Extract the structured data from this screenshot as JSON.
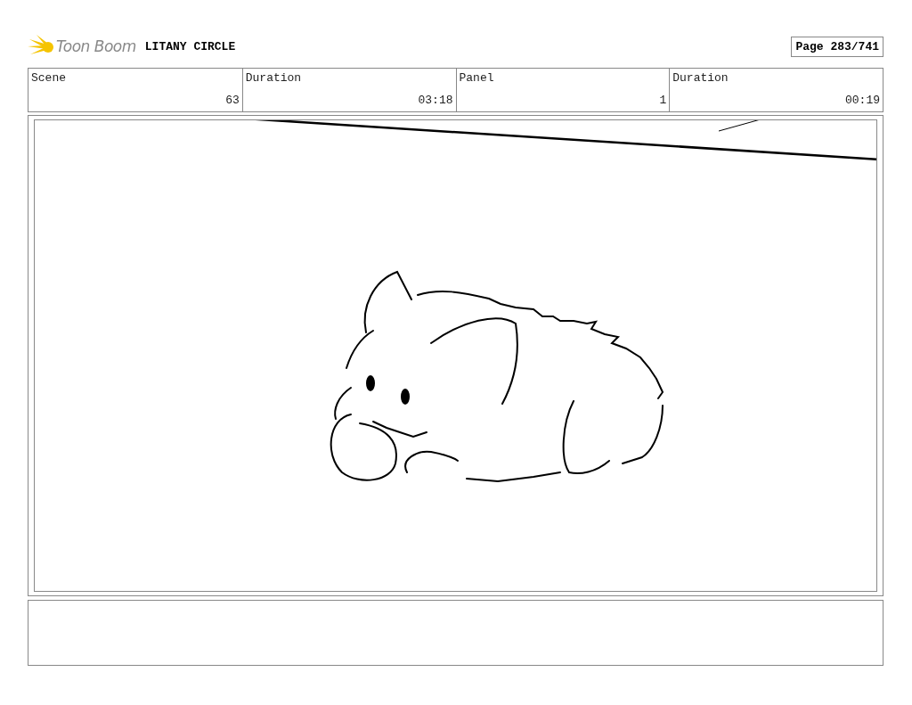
{
  "header": {
    "logo_text": "Toon Boom",
    "project_title": "LITANY CIRCLE",
    "page": "Page 283/741"
  },
  "info_table": {
    "columns": [
      "Scene",
      "Duration",
      "Panel",
      "Duration"
    ],
    "row": [
      "63",
      "03:18",
      "1",
      "00:19"
    ]
  }
}
